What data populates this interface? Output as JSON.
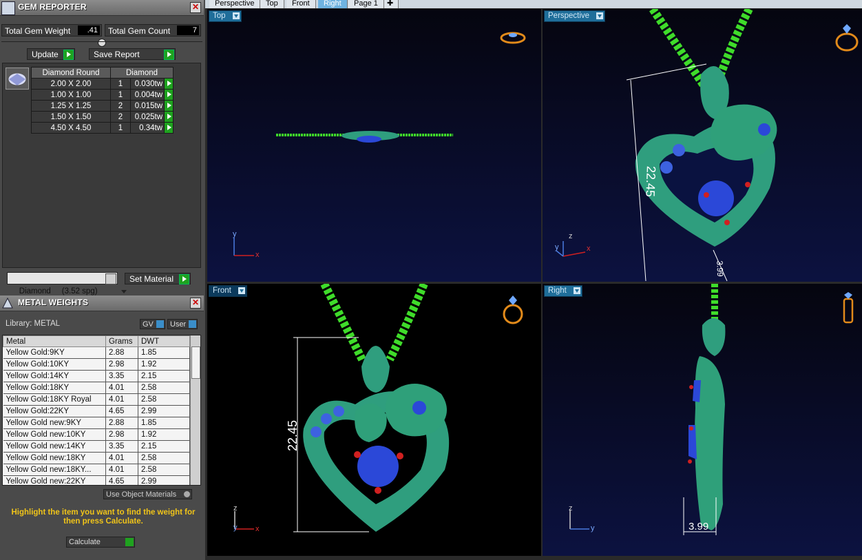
{
  "gem_reporter": {
    "title": "GEM REPORTER",
    "total_weight_label": "Total Gem Weight",
    "total_weight_value": ".41",
    "total_count_label": "Total Gem Count",
    "total_count_value": "7",
    "update_label": "Update",
    "save_report_label": "Save Report",
    "table_headers": [
      "Diamond Round",
      "Diamond"
    ],
    "rows": [
      {
        "size": "2.00 X 2.00",
        "qty": "1",
        "weight": "0.030tw"
      },
      {
        "size": "1.00 X 1.00",
        "qty": "1",
        "weight": "0.004tw"
      },
      {
        "size": "1.25 X 1.25",
        "qty": "2",
        "weight": "0.015tw"
      },
      {
        "size": "1.50 X 1.50",
        "qty": "2",
        "weight": "0.025tw"
      },
      {
        "size": "4.50 X 4.50",
        "qty": "1",
        "weight": "0.34tw"
      }
    ],
    "material_select": "Diamond     (3.52 spg)",
    "set_material_label": "Set Material"
  },
  "metal_weights": {
    "title": "METAL WEIGHTS",
    "library_label": "Library: METAL",
    "gv_label": "GV",
    "user_label": "User",
    "headers": [
      "Metal",
      "Grams",
      "DWT"
    ],
    "rows": [
      {
        "metal": "Yellow Gold:9KY",
        "grams": "2.88",
        "dwt": "1.85"
      },
      {
        "metal": "Yellow Gold:10KY",
        "grams": "2.98",
        "dwt": "1.92"
      },
      {
        "metal": "Yellow Gold:14KY",
        "grams": "3.35",
        "dwt": "2.15"
      },
      {
        "metal": "Yellow Gold:18KY",
        "grams": "4.01",
        "dwt": "2.58"
      },
      {
        "metal": "Yellow Gold:18KY Royal",
        "grams": "4.01",
        "dwt": "2.58"
      },
      {
        "metal": "Yellow Gold:22KY",
        "grams": "4.65",
        "dwt": "2.99"
      },
      {
        "metal": "Yellow Gold new:9KY",
        "grams": "2.88",
        "dwt": "1.85"
      },
      {
        "metal": "Yellow Gold new:10KY",
        "grams": "2.98",
        "dwt": "1.92"
      },
      {
        "metal": "Yellow Gold new:14KY",
        "grams": "3.35",
        "dwt": "2.15"
      },
      {
        "metal": "Yellow Gold new:18KY",
        "grams": "4.01",
        "dwt": "2.58"
      },
      {
        "metal": "Yellow Gold new:18KY...",
        "grams": "4.01",
        "dwt": "2.58"
      },
      {
        "metal": "Yellow Gold new:22KY",
        "grams": "4.65",
        "dwt": "2.99"
      }
    ],
    "use_object_materials": "Use Object Materials",
    "instruction": "Highlight the item you want to find the weight for then press Calculate.",
    "calculate_label": "Calculate"
  },
  "tabs": [
    "Perspective",
    "Top",
    "Front",
    "Right",
    "Page 1"
  ],
  "active_tab": "Right",
  "viewports": {
    "top": {
      "label": "Top"
    },
    "perspective": {
      "label": "Perspective",
      "dim_height": "22.45",
      "dim_depth": "3.99"
    },
    "front": {
      "label": "Front",
      "dim_height": "22.45"
    },
    "right": {
      "label": "Right",
      "dim_depth": "3.99"
    }
  },
  "axis_labels": {
    "x": "x",
    "y": "y",
    "z": "z"
  },
  "colors": {
    "chain": "#3fdc2a",
    "metal": "#2f9e7e",
    "gem_blue": "#2b48d8",
    "prong_red": "#d12020",
    "panel": "#4a4a4a",
    "accent_green": "#1fa21f"
  }
}
